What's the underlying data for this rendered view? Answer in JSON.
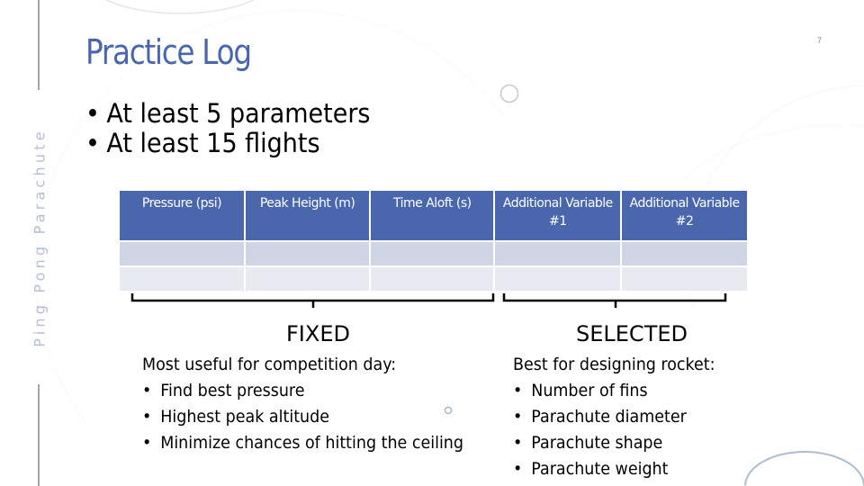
{
  "slide": {
    "side_label": "Ping Pong Parachute",
    "title": "Practice Log",
    "page_number": "7",
    "requirements": [
      "At least 5 parameters",
      "At least 15 flights"
    ],
    "bullet_glyph": "•",
    "table": {
      "columns": [
        "Pressure (psi)",
        "Peak Height (m)",
        "Time Aloft (s)",
        "Additional Variable #1",
        "Additional Variable #2"
      ],
      "rows": [
        [
          "",
          "",
          "",
          "",
          ""
        ],
        [
          "",
          "",
          "",
          "",
          ""
        ]
      ]
    },
    "groups": {
      "fixed": {
        "label": "FIXED",
        "heading": "Most useful for competition day:",
        "items": [
          "Find best pressure",
          "Highest peak altitude",
          "Minimize chances of hitting the ceiling"
        ]
      },
      "selected": {
        "label": "SELECTED",
        "heading": "Best for designing rocket:",
        "items": [
          "Number of fins",
          "Parachute diameter",
          "Parachute shape",
          "Parachute weight"
        ]
      }
    },
    "colors": {
      "accent": "#4a67ad",
      "header_bg": "#4a67ad",
      "row_odd": "#cfd5e4",
      "row_even": "#e8eaf1",
      "side_text": "#b4bed4"
    }
  }
}
